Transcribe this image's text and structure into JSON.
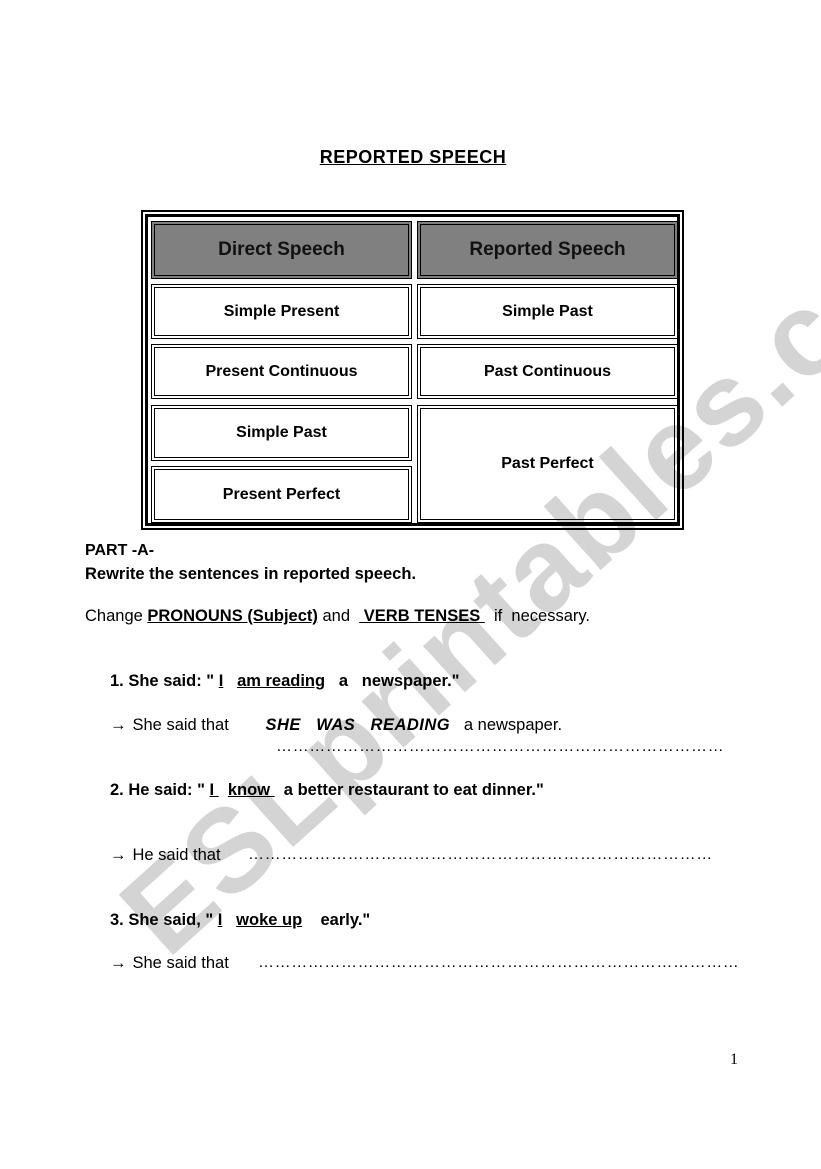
{
  "watermark": "ESLprintables.com",
  "title": "REPORTED SPEECH",
  "table": {
    "headers": [
      "Direct Speech",
      "Reported Speech"
    ],
    "direct": [
      "Simple Present",
      "Present Continuous",
      "Simple Past",
      "Present Perfect"
    ],
    "reported": [
      "Simple Past",
      "Past Continuous",
      "Past Perfect"
    ]
  },
  "part": {
    "label": "PART -A-",
    "instruction": "Rewrite the sentences in reported speech.",
    "change": {
      "prefix": "Change ",
      "pronouns": "PRONOUNS (Subject)",
      "and": " and  ",
      "tenses": " VERB TENSES ",
      "suffix": "  if  necessary."
    }
  },
  "questions": [
    {
      "number": "1.",
      "lead": " She said: \" ",
      "subject": "I",
      "gap1": "   ",
      "verb": "am reading",
      "rest": "   a   newspaper.\"",
      "answer_prefix": "She said that",
      "answer_filled": "SHE   WAS   READING",
      "answer_rest": "   a newspaper.",
      "dots": "………………………………………………………………………"
    },
    {
      "number": "2.",
      "lead": " He said: \" ",
      "subject": "I ",
      "gap1": "  ",
      "verb": "know ",
      "rest": "  a better restaurant to eat dinner.\"",
      "answer_prefix": "He said that",
      "dots": "…………………………………………………………………………"
    },
    {
      "number": "3.",
      "lead": " She said, \" ",
      "subject": "I",
      "gap1": "   ",
      "verb": "woke up",
      "rest": "    early.\"",
      "answer_prefix": "She said that",
      "dots": "……………………………………………………………………………"
    }
  ],
  "arrow": "→",
  "page_number": "1"
}
